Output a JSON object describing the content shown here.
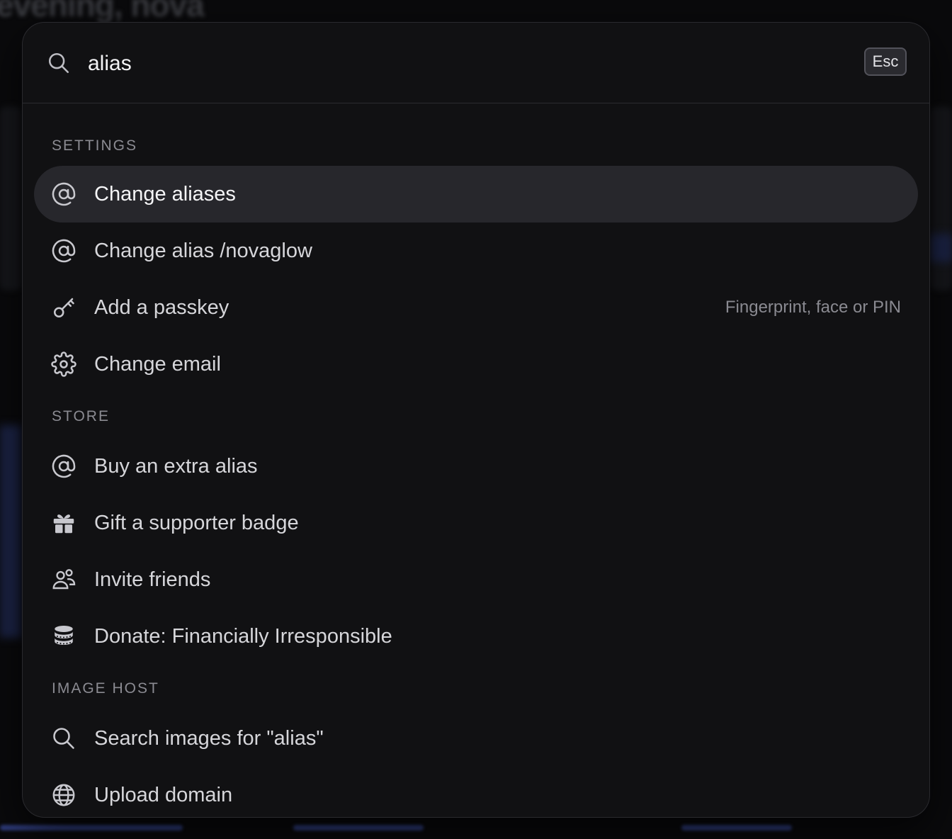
{
  "background": {
    "greeting": "evening, nova"
  },
  "search": {
    "query": "alias",
    "esc_label": "Esc"
  },
  "sections": [
    {
      "title": "SETTINGS",
      "items": [
        {
          "label": "Change aliases",
          "icon": "at-icon",
          "selected": true
        },
        {
          "label": "Change alias /novaglow",
          "icon": "at-icon"
        },
        {
          "label": "Add a passkey",
          "icon": "key-icon",
          "hint": "Fingerprint, face or PIN"
        },
        {
          "label": "Change email",
          "icon": "gear-icon"
        }
      ]
    },
    {
      "title": "STORE",
      "items": [
        {
          "label": "Buy an extra alias",
          "icon": "at-icon"
        },
        {
          "label": "Gift a supporter badge",
          "icon": "gift-icon"
        },
        {
          "label": "Invite friends",
          "icon": "users-icon"
        },
        {
          "label": "Donate: Financially Irresponsible",
          "icon": "coins-icon"
        }
      ]
    },
    {
      "title": "IMAGE HOST",
      "items": [
        {
          "label": "Search images for \"alias\"",
          "icon": "search-icon"
        },
        {
          "label": "Upload domain",
          "icon": "globe-icon"
        }
      ]
    }
  ],
  "colors": {
    "palette_bg": "#111113",
    "selected_bg": "#27272c",
    "text": "#d6d6da",
    "muted": "#8b8b92"
  }
}
